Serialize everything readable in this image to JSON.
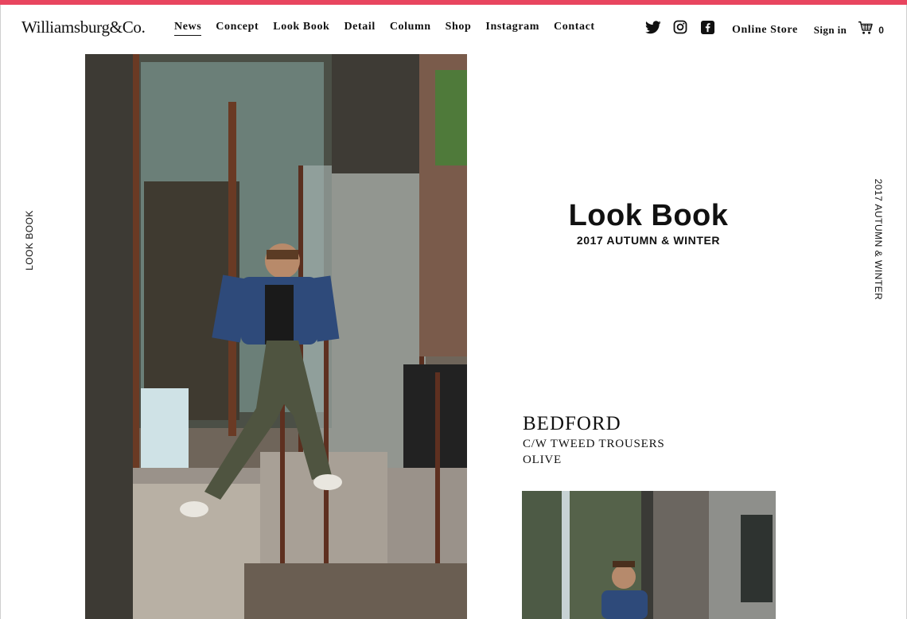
{
  "brand": {
    "logo_text": "Williamsburg&Co."
  },
  "colors": {
    "accent_bar": "#e8455f",
    "text": "#111111"
  },
  "nav": {
    "items": [
      {
        "label": "News",
        "active": true
      },
      {
        "label": "Concept"
      },
      {
        "label": "Look Book"
      },
      {
        "label": "Detail"
      },
      {
        "label": "Column"
      },
      {
        "label": "Shop"
      },
      {
        "label": "Instagram"
      },
      {
        "label": "Contact"
      }
    ]
  },
  "social": {
    "icons": [
      "twitter-icon",
      "instagram-icon",
      "facebook-icon"
    ]
  },
  "header_right": {
    "online_store": "Online Store",
    "sign_in": "Sign in",
    "cart_count": "0"
  },
  "side": {
    "left_label": "LOOK BOOK",
    "right_label": "2017 AUTUMN & WINTER"
  },
  "lookbook": {
    "title": "Look Book",
    "subtitle": "2017 AUTUMN & WINTER"
  },
  "product": {
    "name": "BEDFORD",
    "description": "C/W TWEED TROUSERS",
    "color": "OLIVE"
  }
}
